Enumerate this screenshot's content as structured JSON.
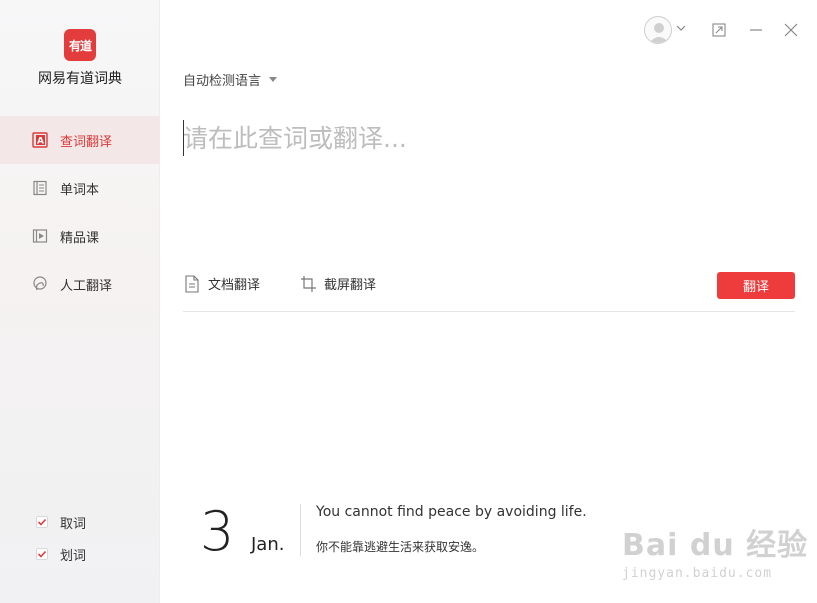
{
  "app": {
    "logo_text": "有道",
    "name": "网易有道词典",
    "brand_color": "#e23c3c"
  },
  "sidebar": {
    "items": [
      {
        "label": "查词翻译",
        "icon": "dictionary-a-icon",
        "active": true
      },
      {
        "label": "单词本",
        "icon": "wordbook-icon",
        "active": false
      },
      {
        "label": "精品课",
        "icon": "course-play-icon",
        "active": false
      },
      {
        "label": "人工翻译",
        "icon": "human-translate-icon",
        "active": false
      }
    ],
    "checks": [
      {
        "label": "取词",
        "checked": true
      },
      {
        "label": "划词",
        "checked": true
      }
    ]
  },
  "titlebar": {
    "avatar_icon": "user-avatar-icon",
    "controls": [
      "restore-icon",
      "minimize-icon",
      "close-icon"
    ]
  },
  "main": {
    "language_selector": "自动检测语言",
    "input_placeholder": "请在此查词或翻译...",
    "tools": [
      {
        "label": "文档翻译",
        "icon": "document-icon"
      },
      {
        "label": "截屏翻译",
        "icon": "crop-icon"
      }
    ],
    "translate_button": "翻译",
    "accent_color": "#ee3c3c"
  },
  "daily": {
    "day": "3",
    "month": "Jan.",
    "quote_en": "You cannot find peace by avoiding life.",
    "quote_zh": "你不能靠逃避生活来获取安逸。"
  },
  "watermark": {
    "main": "Bai du 经验",
    "sub": "jingyan.baidu.com"
  }
}
